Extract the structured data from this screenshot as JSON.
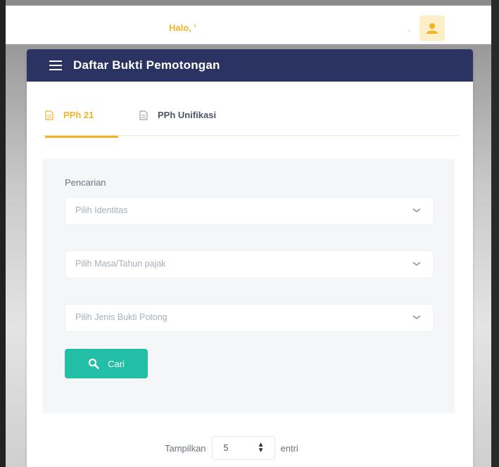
{
  "header": {
    "greeting": "Halo, '",
    "dot": "."
  },
  "card": {
    "title": "Daftar Bukti Pemotongan"
  },
  "tabs": [
    {
      "label": "PPh 21",
      "active": true
    },
    {
      "label": "PPh Unifikasi",
      "active": false
    }
  ],
  "search": {
    "label": "Pencarian",
    "identitas_placeholder": "Pilih Identitas",
    "masa_placeholder": "Pilih Masa/Tahun pajak",
    "jenis_placeholder": "Pilih Jenis Bukti Potong",
    "button_label": "Cari"
  },
  "entries": {
    "prefix": "Tampilkan",
    "value": "5",
    "suffix": "entri"
  },
  "colors": {
    "header_bg": "#2a3361",
    "accent": "#f0b429",
    "button": "#22bfa6"
  },
  "icons": [
    "user-icon",
    "menu-icon",
    "document-icon",
    "chevron-down-icon",
    "search-icon",
    "sort-icon"
  ]
}
